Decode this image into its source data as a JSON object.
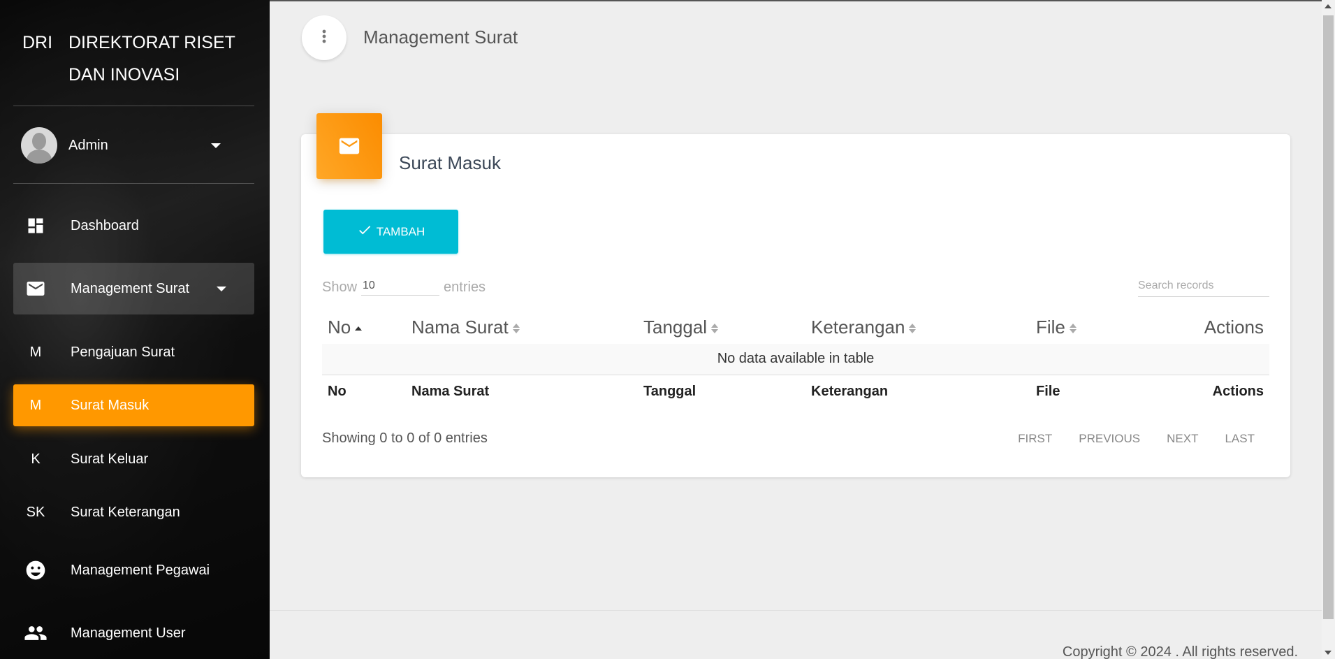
{
  "sidebar": {
    "logo_mini": "DRI",
    "logo_normal": "DIREKTORAT RISET DAN INOVASI",
    "user": {
      "name": "Admin"
    },
    "nav": {
      "dashboard": {
        "label": "Dashboard",
        "icon": "dashboard-icon"
      },
      "management_surat": {
        "label": "Management Surat",
        "icon": "mail-icon"
      },
      "pengajuan_surat": {
        "label": "Pengajuan Surat",
        "mini": "M"
      },
      "surat_masuk": {
        "label": "Surat Masuk",
        "mini": "M"
      },
      "surat_keluar": {
        "label": "Surat Keluar",
        "mini": "K"
      },
      "surat_keterangan": {
        "label": "Surat Keterangan",
        "mini": "SK"
      },
      "management_pegawai": {
        "label": "Management Pegawai",
        "icon": "face-icon"
      },
      "management_user": {
        "label": "Management User",
        "icon": "people-icon"
      }
    }
  },
  "header": {
    "title": "Management Surat"
  },
  "card": {
    "title": "Surat Masuk",
    "icon": "mail-icon",
    "add_button": "TAMBAH",
    "show_label": "Show",
    "entries_label": "entries",
    "page_length": "10",
    "search_placeholder": "Search records",
    "table": {
      "headers": [
        "No",
        "Nama Surat",
        "Tanggal",
        "Keterangan",
        "File",
        "Actions"
      ],
      "empty_message": "No data available in table"
    },
    "info": "Showing 0 to 0 of 0 entries",
    "pagination": {
      "first": "FIRST",
      "previous": "PREVIOUS",
      "next": "NEXT",
      "last": "LAST"
    }
  },
  "footer": {
    "copyright": "Copyright © 2024 . All rights reserved."
  },
  "colors": {
    "accent": "#ff9800",
    "button": "#00bcd4",
    "background": "#eeeeee"
  }
}
